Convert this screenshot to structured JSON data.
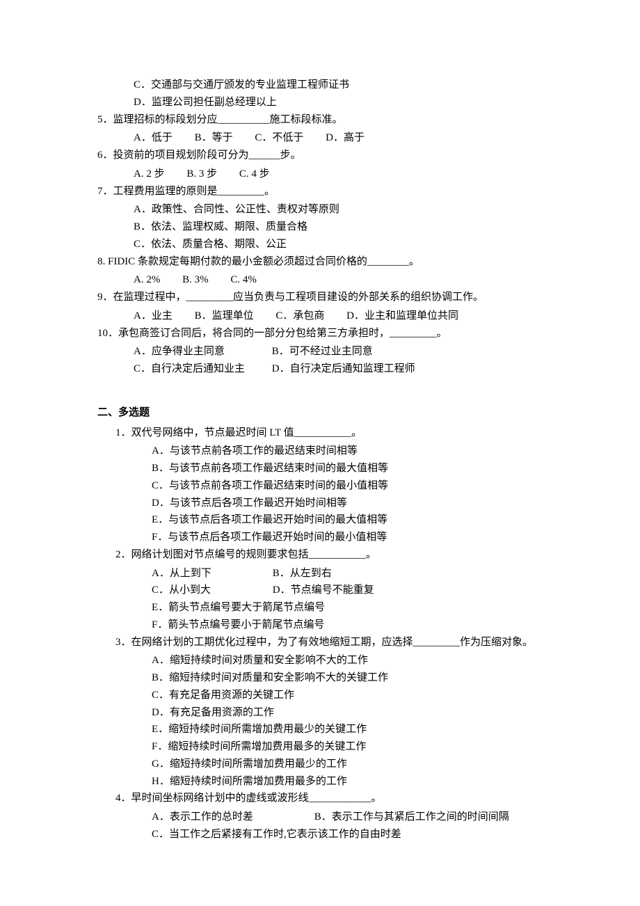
{
  "section1": {
    "q_cont_c": "C．交通部与交通厅颁发的专业监理工程师证书",
    "q_cont_d": "D．监理公司担任副总经理以上",
    "q5": {
      "stem": "5．监理招标的标段划分应__________施工标段标准。",
      "a": "A．低于",
      "b": "B．等于",
      "c": "C．不低于",
      "d": "D．高于"
    },
    "q6": {
      "stem": "6．投资前的项目规划阶段可分为______步。",
      "a": "A. 2 步",
      "b": "B. 3 步",
      "c": "C. 4 步"
    },
    "q7": {
      "stem": "7．工程费用监理的原则是_________。",
      "a": "A．政策性、合同性、公正性、责权对等原则",
      "b": "B．依法、监理权威、期限、质量合格",
      "c": "C．依法、质量合格、期限、公正"
    },
    "q8": {
      "stem": "8. FIDIC 条款规定每期付款的最小金额必须超过合同价格的________。",
      "a": "A. 2%",
      "b": "B. 3%",
      "c": "C. 4%"
    },
    "q9": {
      "stem": "9．在监理过程中，_________应当负责与工程项目建设的外部关系的组织协调工作。",
      "a": "A．业主",
      "b": "B．监理单位",
      "c": "C．承包商",
      "d": "D．业主和监理单位共同"
    },
    "q10": {
      "stem": "10．承包商签订合同后，将合同的一部分分包给第三方承担时，_________。",
      "a": "A．应争得业主同意",
      "b": "B．可不经过业主同意",
      "c": "C．自行决定后通知业主",
      "d": "D．自行决定后通知监理工程师"
    }
  },
  "section2": {
    "title": "二、多选题",
    "q1": {
      "stem": "1．双代号网络中，节点最迟时间 LT 值___________。",
      "a": "A．与该节点前各项工作的最迟结束时间相等",
      "b": "B．与该节点前各项工作最迟结束时间的最大值相等",
      "c": "C．与该节点前各项工作最迟结束时间的最小值相等",
      "d": "D．与该节点后各项工作最迟开始时间相等",
      "e": "E．与该节点后各项工作最迟开始时间的最大值相等",
      "f": "F．与该节点后各项工作最迟开始时间的最小值相等"
    },
    "q2": {
      "stem": "2．网络计划图对节点编号的规则要求包括___________。",
      "a": "A．从上到下",
      "b": "B．从左到右",
      "c": "C．从小到大",
      "d": "D．节点编号不能重复",
      "e": "E．箭头节点编号要大于箭尾节点编号",
      "f": "F．箭头节点编号要小于箭尾节点编号"
    },
    "q3": {
      "stem": "3．在网络计划的工期优化过程中，为了有效地缩短工期，应选择_________作为压缩对象。",
      "a": "A．缩短持续时间对质量和安全影响不大的工作",
      "b": "B．缩短持续时间对质量和安全影响不大的关键工作",
      "c": "C．有充足备用资源的关键工作",
      "d": "D．有充足备用资源的工作",
      "e": "E．缩短持续时间所需增加费用最少的关键工作",
      "f": "F．缩短持续时间所需增加费用最多的关键工作",
      "g": "G．缩短持续时间所需增加费用最少的工作",
      "h": "H．缩短持续时间所需增加费用最多的工作"
    },
    "q4": {
      "stem": "4．早时间坐标网络计划中的虚线或波形线____________。",
      "a": "A．表示工作的总时差",
      "b": "B．表示工作与其紧后工作之间的时间间隔",
      "c": "C．当工作之后紧接有工作时,它表示该工作的自由时差"
    }
  }
}
